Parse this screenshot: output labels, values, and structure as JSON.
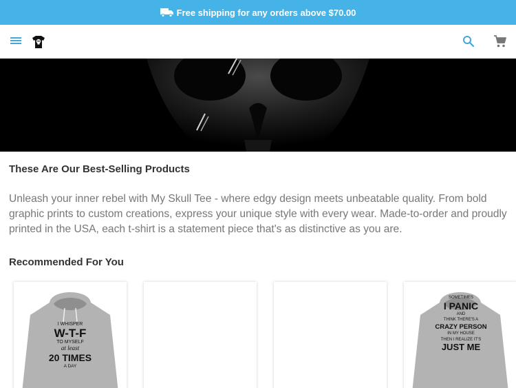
{
  "promo": {
    "icon": "truck-icon",
    "text": "Free shipping for any orders above $70.00"
  },
  "header": {
    "menu_icon": "menu-icon",
    "logo_icon": "skull-tee-logo",
    "search_icon": "search-icon",
    "cart_icon": "cart-icon"
  },
  "main": {
    "section_title": "These Are Our Best-Selling Products",
    "description": "Unleash your inner rebel with My Skull Tee - where edgy design meets unbeatable quality. From bold graphic prints to custom creations, express your unique style with every wear. Made-to-order and proudly printed in the USA, each t-shirt is a statement piece that's as distinctive as you are.",
    "recommended_title": "Recommended For You"
  },
  "products": [
    {
      "print_lines": [
        "I WHISPER",
        "W-T-F",
        "TO MYSELF",
        "at least",
        "20 TIMES",
        "A DAY"
      ]
    },
    {
      "print_lines": []
    },
    {
      "print_lines": []
    },
    {
      "print_lines": [
        "SOMETIMES",
        "I PANIC",
        "AND",
        "THINK THERE'S A",
        "CRAZY PERSON",
        "IN MY HOUSE",
        "THEN I REALIZE IT'S",
        "JUST ME"
      ]
    }
  ],
  "colors": {
    "promo_bar": "#45b3e7",
    "accent": "#45a6d8",
    "hoodie_grey": "#b3b3b3",
    "hero_background": "#000000"
  }
}
